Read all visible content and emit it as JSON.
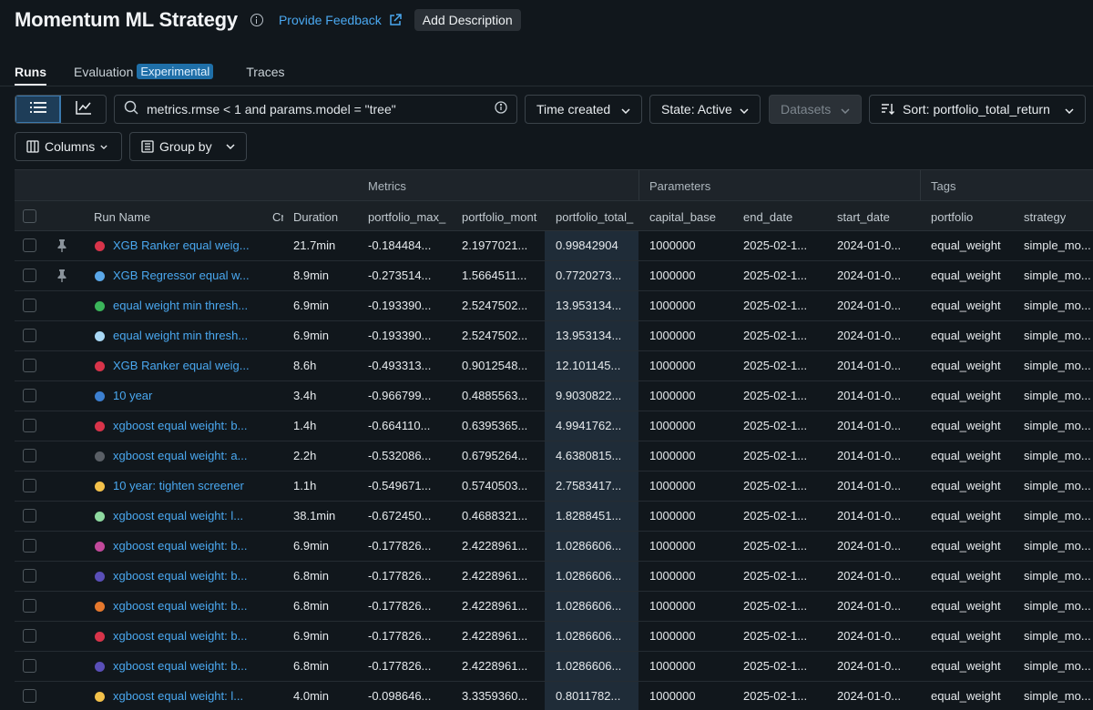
{
  "header": {
    "title": "Momentum ML Strategy",
    "feedback_label": "Provide Feedback",
    "add_description_label": "Add Description"
  },
  "tabs": {
    "runs": "Runs",
    "evaluation": "Evaluation",
    "experimental_badge": "Experimental",
    "traces": "Traces"
  },
  "toolbar": {
    "search_value": "metrics.rmse < 1 and params.model = \"tree\"",
    "time_created": "Time created",
    "state": "State: Active",
    "datasets": "Datasets",
    "sort": "Sort: portfolio_total_return",
    "columns": "Columns",
    "group_by": "Group by"
  },
  "table": {
    "groups": {
      "metrics": "Metrics",
      "parameters": "Parameters",
      "tags": "Tags"
    },
    "columns": {
      "run_name": "Run Name",
      "created": "Cr",
      "duration": "Duration",
      "max": "portfolio_max_",
      "mont": "portfolio_mont",
      "total": "portfolio_total_",
      "capital": "capital_base",
      "end": "end_date",
      "start": "start_date",
      "portfolio": "portfolio",
      "strategy": "strategy"
    },
    "rows": [
      {
        "pinned": true,
        "color": "#d8344a",
        "name": "XGB Ranker equal weig...",
        "duration": "21.7min",
        "max": "-0.184484...",
        "mont": "2.1977021...",
        "total": "0.99842904",
        "capital": "1000000",
        "end": "2025-02-1...",
        "start": "2024-01-0...",
        "portfolio": "equal_weight",
        "strategy": "simple_mo..."
      },
      {
        "pinned": true,
        "color": "#5aa7e8",
        "name": "XGB Regressor equal w...",
        "duration": "8.9min",
        "max": "-0.273514...",
        "mont": "1.5664511...",
        "total": "0.7720273...",
        "capital": "1000000",
        "end": "2025-02-1...",
        "start": "2024-01-0...",
        "portfolio": "equal_weight",
        "strategy": "simple_mo..."
      },
      {
        "pinned": false,
        "color": "#3bb55a",
        "name": "equal weight min thresh...",
        "duration": "6.9min",
        "max": "-0.193390...",
        "mont": "2.5247502...",
        "total": "13.953134...",
        "capital": "1000000",
        "end": "2025-02-1...",
        "start": "2024-01-0...",
        "portfolio": "equal_weight",
        "strategy": "simple_mo..."
      },
      {
        "pinned": false,
        "color": "#a9d8f5",
        "name": "equal weight min thresh...",
        "duration": "6.9min",
        "max": "-0.193390...",
        "mont": "2.5247502...",
        "total": "13.953134...",
        "capital": "1000000",
        "end": "2025-02-1...",
        "start": "2024-01-0...",
        "portfolio": "equal_weight",
        "strategy": "simple_mo..."
      },
      {
        "pinned": false,
        "color": "#d8344a",
        "name": "XGB Ranker equal weig...",
        "duration": "8.6h",
        "max": "-0.493313...",
        "mont": "0.9012548...",
        "total": "12.101145...",
        "capital": "1000000",
        "end": "2025-02-1...",
        "start": "2014-01-0...",
        "portfolio": "equal_weight",
        "strategy": "simple_mo..."
      },
      {
        "pinned": false,
        "color": "#3c7fd0",
        "name": "10 year",
        "duration": "3.4h",
        "max": "-0.966799...",
        "mont": "0.4885563...",
        "total": "9.9030822...",
        "capital": "1000000",
        "end": "2025-02-1...",
        "start": "2014-01-0...",
        "portfolio": "equal_weight",
        "strategy": "simple_mo..."
      },
      {
        "pinned": false,
        "color": "#d8344a",
        "name": "xgboost equal weight: b...",
        "duration": "1.4h",
        "max": "-0.664110...",
        "mont": "0.6395365...",
        "total": "4.9941762...",
        "capital": "1000000",
        "end": "2025-02-1...",
        "start": "2014-01-0...",
        "portfolio": "equal_weight",
        "strategy": "simple_mo..."
      },
      {
        "pinned": false,
        "color": "#5a5f66",
        "name": "xgboost equal weight: a...",
        "duration": "2.2h",
        "max": "-0.532086...",
        "mont": "0.6795264...",
        "total": "4.6380815...",
        "capital": "1000000",
        "end": "2025-02-1...",
        "start": "2014-01-0...",
        "portfolio": "equal_weight",
        "strategy": "simple_mo..."
      },
      {
        "pinned": false,
        "color": "#f3c14a",
        "name": "10 year: tighten screener",
        "duration": "1.1h",
        "max": "-0.549671...",
        "mont": "0.5740503...",
        "total": "2.7583417...",
        "capital": "1000000",
        "end": "2025-02-1...",
        "start": "2014-01-0...",
        "portfolio": "equal_weight",
        "strategy": "simple_mo..."
      },
      {
        "pinned": false,
        "color": "#8ed9a0",
        "name": "xgboost equal weight: l...",
        "duration": "38.1min",
        "max": "-0.672450...",
        "mont": "0.4688321...",
        "total": "1.8288451...",
        "capital": "1000000",
        "end": "2025-02-1...",
        "start": "2014-01-0...",
        "portfolio": "equal_weight",
        "strategy": "simple_mo..."
      },
      {
        "pinned": false,
        "color": "#c2499b",
        "name": "xgboost equal weight: b...",
        "duration": "6.9min",
        "max": "-0.177826...",
        "mont": "2.4228961...",
        "total": "1.0286606...",
        "capital": "1000000",
        "end": "2025-02-1...",
        "start": "2024-01-0...",
        "portfolio": "equal_weight",
        "strategy": "simple_mo..."
      },
      {
        "pinned": false,
        "color": "#5a4fb8",
        "name": "xgboost equal weight: b...",
        "duration": "6.8min",
        "max": "-0.177826...",
        "mont": "2.4228961...",
        "total": "1.0286606...",
        "capital": "1000000",
        "end": "2025-02-1...",
        "start": "2024-01-0...",
        "portfolio": "equal_weight",
        "strategy": "simple_mo..."
      },
      {
        "pinned": false,
        "color": "#e5782d",
        "name": "xgboost equal weight: b...",
        "duration": "6.8min",
        "max": "-0.177826...",
        "mont": "2.4228961...",
        "total": "1.0286606...",
        "capital": "1000000",
        "end": "2025-02-1...",
        "start": "2024-01-0...",
        "portfolio": "equal_weight",
        "strategy": "simple_mo..."
      },
      {
        "pinned": false,
        "color": "#d8344a",
        "name": "xgboost equal weight: b...",
        "duration": "6.9min",
        "max": "-0.177826...",
        "mont": "2.4228961...",
        "total": "1.0286606...",
        "capital": "1000000",
        "end": "2025-02-1...",
        "start": "2024-01-0...",
        "portfolio": "equal_weight",
        "strategy": "simple_mo..."
      },
      {
        "pinned": false,
        "color": "#5a4fb8",
        "name": "xgboost equal weight: b...",
        "duration": "6.8min",
        "max": "-0.177826...",
        "mont": "2.4228961...",
        "total": "1.0286606...",
        "capital": "1000000",
        "end": "2025-02-1...",
        "start": "2024-01-0...",
        "portfolio": "equal_weight",
        "strategy": "simple_mo..."
      },
      {
        "pinned": false,
        "color": "#f3c14a",
        "name": "xgboost equal weight: l...",
        "duration": "4.0min",
        "max": "-0.098646...",
        "mont": "3.3359360...",
        "total": "0.8011782...",
        "capital": "1000000",
        "end": "2025-02-1...",
        "start": "2024-01-0...",
        "portfolio": "equal_weight",
        "strategy": "simple_mo..."
      }
    ]
  }
}
